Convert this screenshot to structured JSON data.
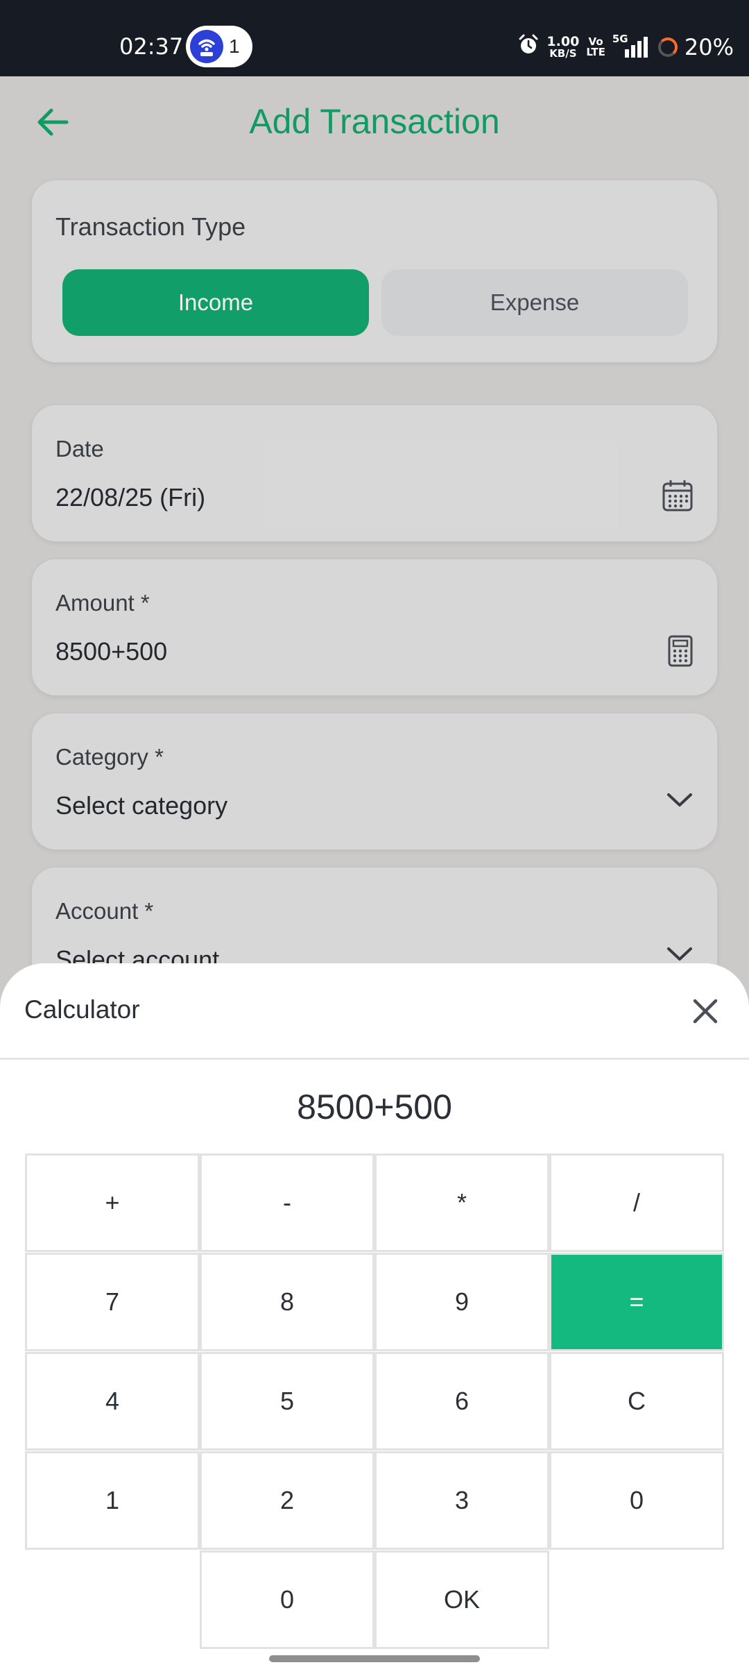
{
  "status_bar": {
    "time": "02:37",
    "notification_count": "1",
    "net_speed_value": "1.00",
    "net_speed_unit": "KB/S",
    "volte_top": "Vo",
    "volte_bottom": "LTE",
    "network": "5G",
    "battery": "20%"
  },
  "header": {
    "title": "Add Transaction"
  },
  "transaction_type": {
    "label": "Transaction Type",
    "income_label": "Income",
    "expense_label": "Expense",
    "selected": "Income"
  },
  "date": {
    "label": "Date",
    "value": "22/08/25 (Fri)"
  },
  "amount": {
    "label": "Amount *",
    "value": "8500+500"
  },
  "category": {
    "label": "Category *",
    "value": "Select category"
  },
  "account": {
    "label": "Account *",
    "value": "Select account"
  },
  "calculator": {
    "title": "Calculator",
    "display": "8500+500",
    "keys": {
      "plus": "+",
      "minus": "-",
      "multiply": "*",
      "divide": "/",
      "k7": "7",
      "k8": "8",
      "k9": "9",
      "equals": "=",
      "k4": "4",
      "k5": "5",
      "k6": "6",
      "clear": "C",
      "k1": "1",
      "k2": "2",
      "k3": "3",
      "k0_right": "0",
      "k0_bottom": "0",
      "ok": "OK"
    }
  },
  "colors": {
    "accent": "#14a86f",
    "equals_key": "#13b97f",
    "status_bar_bg": "#171b24",
    "card_bg": "#e5e5e5"
  }
}
